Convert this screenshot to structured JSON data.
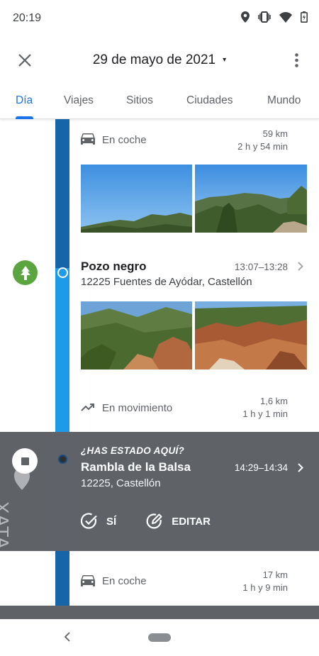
{
  "status_bar": {
    "time": "20:19",
    "icons": [
      "location-icon",
      "vibrate-icon",
      "wifi-icon",
      "battery-icon"
    ]
  },
  "app_bar": {
    "date": "29 de mayo de 2021",
    "caret": "▾",
    "close_icon": "close-icon",
    "more_icon": "more-vert-icon"
  },
  "tabs": [
    {
      "label": "Día",
      "active": true
    },
    {
      "label": "Viajes",
      "active": false
    },
    {
      "label": "Sitios",
      "active": false
    },
    {
      "label": "Ciudades",
      "active": false
    },
    {
      "label": "Mundo",
      "active": false
    }
  ],
  "timeline": {
    "segment_1": {
      "mode": "En coche",
      "icon": "car-icon",
      "distance": "59 km",
      "duration": "2 h y 54 min"
    },
    "place_1": {
      "name": "Pozo negro",
      "address": "12225 Fuentes de Ayódar, Castellón",
      "time": "13:07–13:28",
      "icon": "tree-icon"
    },
    "segment_2": {
      "mode": "En movimiento",
      "icon": "trending-icon",
      "distance": "1,6 km",
      "duration": "1 h y 1 min"
    },
    "ask_card": {
      "question": "¿HAS ESTADO AQUÍ?",
      "name": "Rambla de la Balsa",
      "address": "12225, Castellón",
      "time": "14:29–14:34",
      "yes_label": "SÍ",
      "edit_label": "EDITAR"
    },
    "segment_3": {
      "mode": "En coche",
      "icon": "car-icon",
      "distance": "17 km",
      "duration": "1 h y 9 min"
    }
  },
  "watermark": "XATAKA",
  "colors": {
    "accent": "#1a73e8",
    "rail_dark": "#1565a8",
    "rail_light": "#1e9be8",
    "card": "#5f6368",
    "place_icon": "#5aa53f"
  }
}
